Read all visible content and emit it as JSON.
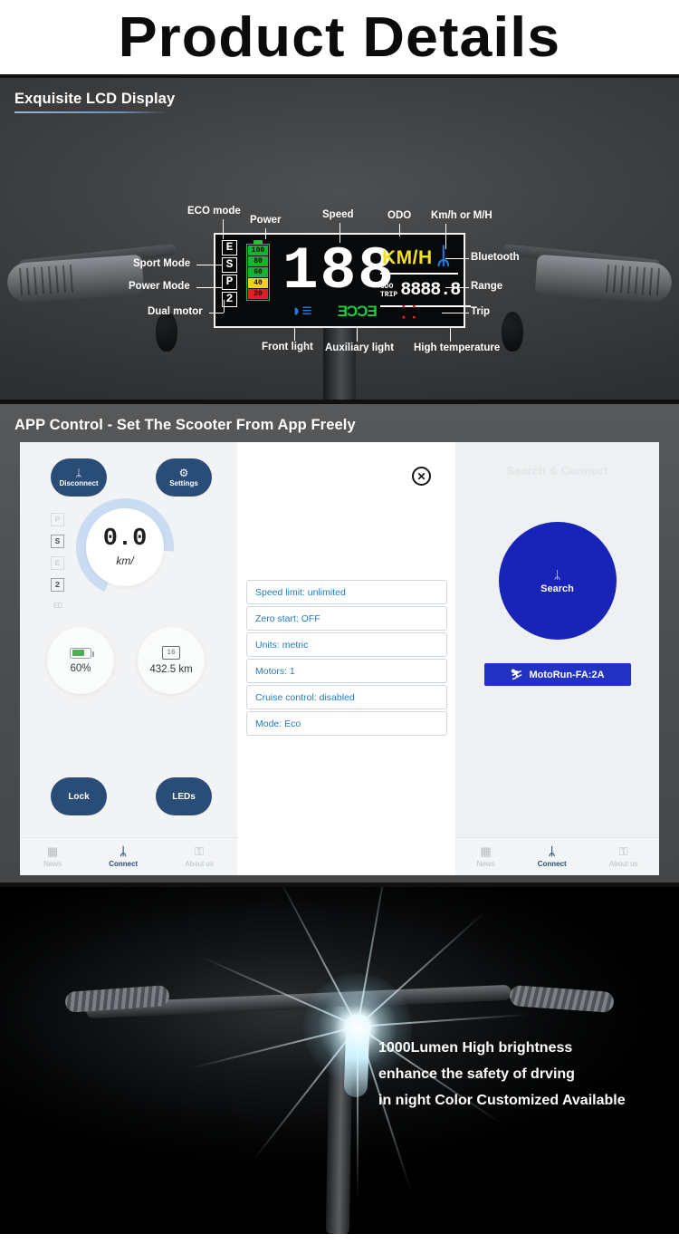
{
  "header": {
    "title": "Product Details"
  },
  "lcd_section": {
    "heading": "Exquisite LCD Display",
    "callouts": {
      "eco_mode": "ECO mode",
      "power": "Power",
      "speed": "Speed",
      "odo": "ODO",
      "unit_switch": "Km/h or M/H",
      "sport_mode": "Sport Mode",
      "power_mode": "Power Mode",
      "dual_motor": "Dual motor",
      "bluetooth": "Bluetooth",
      "range": "Range",
      "trip": "Trip",
      "front_light": "Front light",
      "auxiliary_light": "Auxiliary light",
      "high_temperature": "High temperature"
    },
    "display": {
      "mode_letters": [
        "E",
        "S",
        "P",
        "2"
      ],
      "battery_segments": [
        {
          "label": "100",
          "color": "#18b52c"
        },
        {
          "label": "80",
          "color": "#18b52c"
        },
        {
          "label": "60",
          "color": "#18b52c"
        },
        {
          "label": "40",
          "color": "#e8d51d"
        },
        {
          "label": "20",
          "color": "#e02020"
        }
      ],
      "speed_value": "188",
      "unit": "KM/H",
      "bluetooth_glyph": "ᛦ",
      "odo_label": "ODO",
      "trip_label": "TRIP",
      "odo_value": "8888.8",
      "front_light_glyph": "◗≡",
      "aux_light_glyph": "ƎƆƆƎ",
      "temp_glyph": "⸬"
    }
  },
  "app_section": {
    "heading": "APP Control - Set The Scooter From App Freely",
    "left_panel": {
      "disconnect_button": {
        "label": "Disconnect",
        "glyph": "ᛦ"
      },
      "settings_button": {
        "label": "Settings",
        "glyph": "⚙"
      },
      "mode_indicators": [
        "P",
        "S",
        "E",
        "2",
        "ED"
      ],
      "speed_value": "0.0",
      "speed_unit": "km/",
      "battery_percent": "60%",
      "odometer": "432.5 km",
      "odometer_icon_text": "16",
      "lock_button": "Lock",
      "leds_button": "LEDs"
    },
    "middle_panel": {
      "close_label": "✕",
      "settings_rows": [
        "Speed limit: unlimited",
        "Zero start: OFF",
        "Units: metric",
        "Motors: 1",
        "Cruise control: disabled",
        "Mode: Eco"
      ]
    },
    "right_panel": {
      "title": "Search & Connect",
      "search_button": {
        "label": "Search",
        "glyph": "ᛦ"
      },
      "device_button": {
        "label": "MotoRun-FA:2A",
        "glyph": "⛷"
      }
    },
    "tabbar": {
      "news": "News",
      "connect": "Connect",
      "about": "About us"
    }
  },
  "light_section": {
    "line1": "1000Lumen High brightness",
    "line2": "enhance the safety of drving",
    "line3": "in night Color Customized Available"
  }
}
